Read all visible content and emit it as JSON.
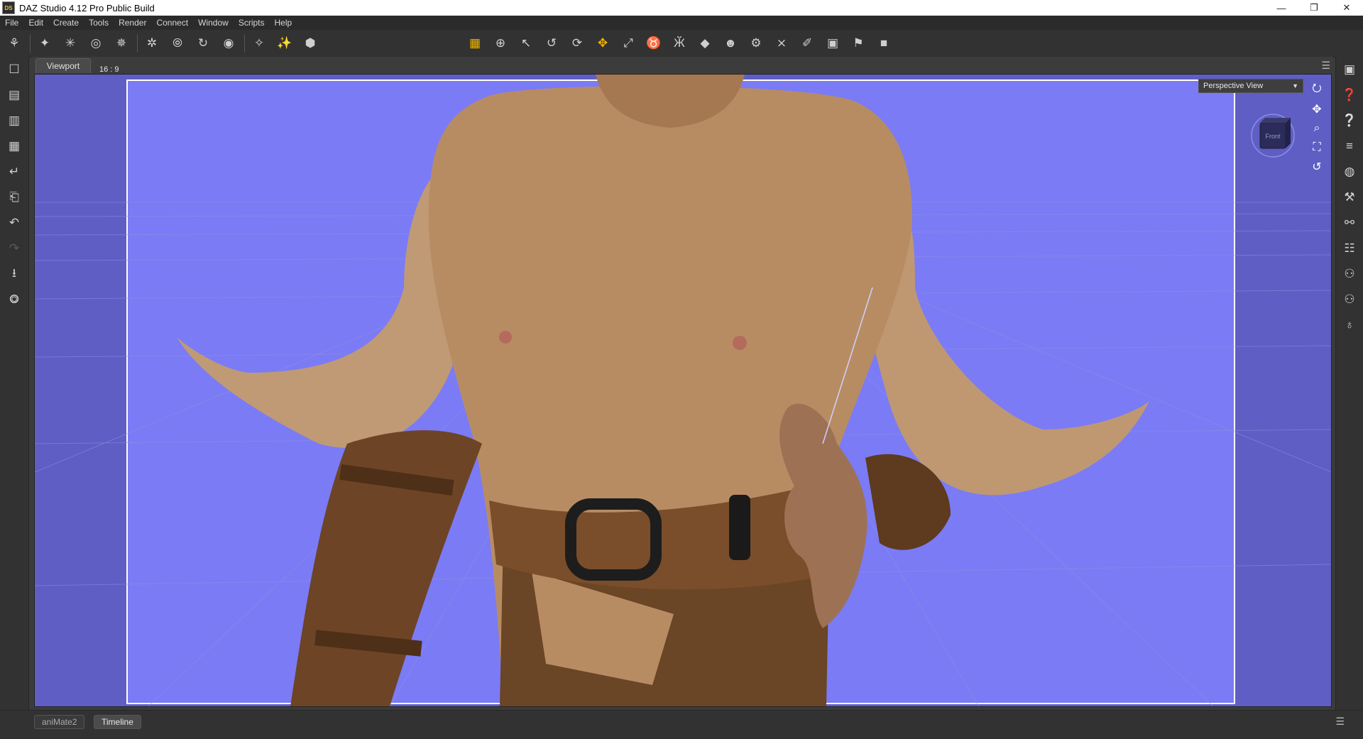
{
  "window": {
    "title": "DAZ Studio 4.12 Pro Public Build",
    "app_icon_text": "DS",
    "minimize": "—",
    "restore": "❐",
    "close": "✕"
  },
  "menu": [
    "File",
    "Edit",
    "Create",
    "Tools",
    "Render",
    "Connect",
    "Window",
    "Scripts",
    "Help"
  ],
  "toolbar": {
    "left_icons": [
      "⚘",
      "✦",
      "✳",
      "◎",
      "✵",
      "✲",
      "⦾",
      "↻",
      "◉",
      "✧",
      "✨",
      "⬢"
    ],
    "center_icons": [
      "▦",
      "⊕",
      "↖",
      "↺",
      "⟳",
      "✥",
      "⤢",
      "♉",
      "Ӂ",
      "◆",
      "☻",
      "⚙",
      "⨯",
      "✐",
      "▣",
      "⚑",
      "■"
    ]
  },
  "left_bar": [
    "☐",
    "▤",
    "▥",
    "▦",
    "↵",
    "⎗",
    "↶",
    "↷",
    "⭳",
    "⭗"
  ],
  "right_bar": [
    "▣",
    "❓",
    "❔",
    "≡",
    "◍",
    "⚒",
    "⚯",
    "☷",
    "⚇",
    "⚇",
    "♁"
  ],
  "pane": {
    "tab_label": "Viewport",
    "menu_icon": "☰",
    "aspect_label": "16 : 9",
    "view_selector": "Perspective View",
    "view_cube_label": "Front",
    "cam_tools": [
      "⭮",
      "✥",
      "⌕",
      "⛶",
      "↺"
    ]
  },
  "bottom": {
    "tabs": [
      "aniMate2",
      "Timeline"
    ],
    "active_tab": "Timeline",
    "menu_icon": "☰"
  },
  "colors": {
    "viewport_bg": "#6f6fd8",
    "skin": "#b98d66",
    "leather": "#6b4424"
  }
}
